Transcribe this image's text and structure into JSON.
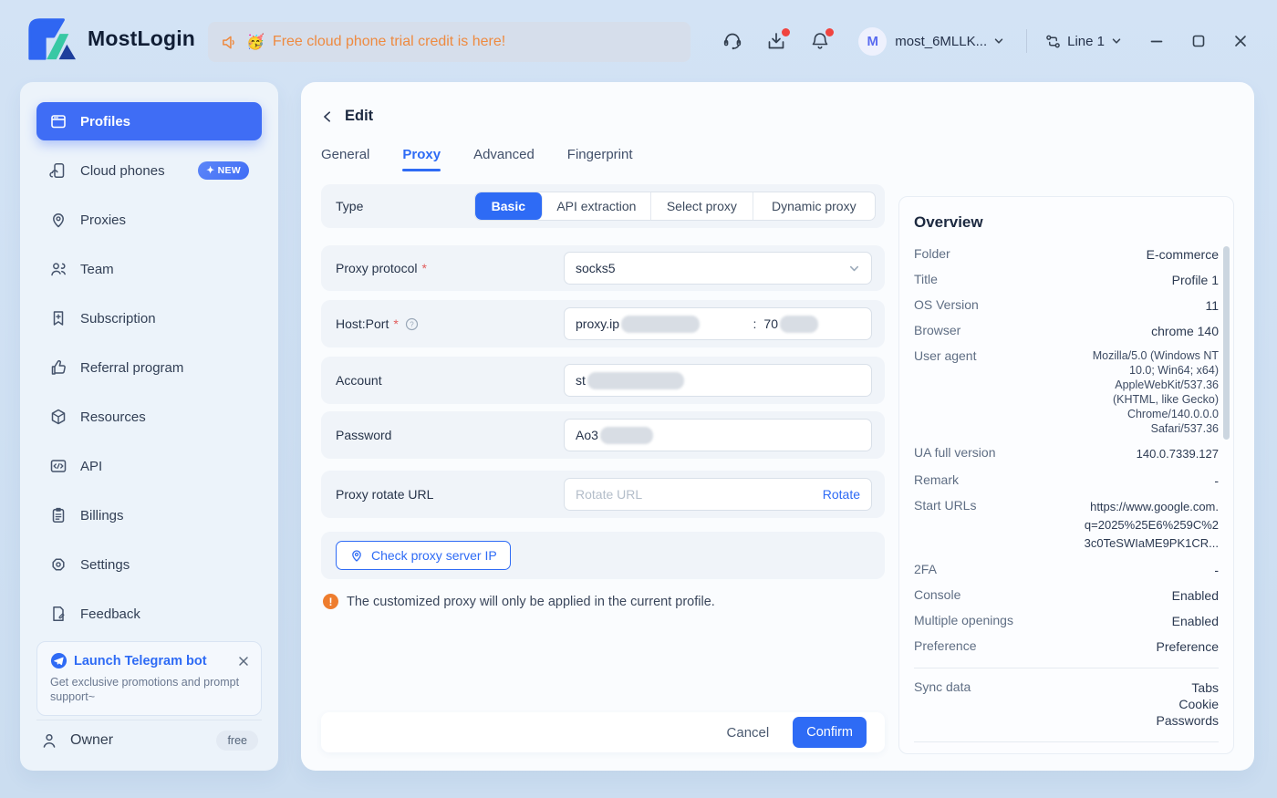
{
  "topbar": {
    "brand": "MostLogin",
    "banner": {
      "emoji": "🥳",
      "text": "Free cloud phone trial credit is here!"
    },
    "user": {
      "initial": "M",
      "name": "most_6MLLK..."
    },
    "line_label": "Line 1"
  },
  "sidebar": {
    "items": [
      {
        "label": "Profiles"
      },
      {
        "label": "Cloud phones",
        "badge": "✦ NEW"
      },
      {
        "label": "Proxies"
      },
      {
        "label": "Team"
      },
      {
        "label": "Subscription"
      },
      {
        "label": "Referral program"
      },
      {
        "label": "Resources"
      },
      {
        "label": "API"
      },
      {
        "label": "Billings"
      },
      {
        "label": "Settings"
      },
      {
        "label": "Feedback"
      }
    ],
    "telegram_card": {
      "title": "Launch Telegram bot",
      "subtitle": "Get exclusive promotions and prompt support~"
    },
    "owner": {
      "label": "Owner",
      "badge": "free"
    }
  },
  "main": {
    "back_title": "Edit",
    "tabs": [
      "General",
      "Proxy",
      "Advanced",
      "Fingerprint"
    ],
    "active_tab": "Proxy",
    "form": {
      "required_mark": "*",
      "type_label": "Type",
      "type_options": [
        "Basic",
        "API extraction",
        "Select proxy",
        "Dynamic proxy"
      ],
      "type_selected": "Basic",
      "proxy_protocol_label": "Proxy protocol",
      "proxy_protocol_value": "socks5",
      "host_port_label": "Host:Port",
      "host_value": "proxy.ip",
      "host_port_separator": ":",
      "port_value": "70",
      "account_label": "Account",
      "account_value": "st",
      "password_label": "Password",
      "password_value": "Ao3",
      "rotate_label": "Proxy rotate URL",
      "rotate_placeholder": "Rotate URL",
      "rotate_action": "Rotate",
      "check_ip_button": "Check proxy server IP",
      "notice": "The customized proxy will only be applied in the current profile.",
      "cancel": "Cancel",
      "confirm": "Confirm"
    }
  },
  "overview": {
    "title": "Overview",
    "rows": [
      {
        "label": "Folder",
        "value": "E-commerce"
      },
      {
        "label": "Title",
        "value": "Profile 1"
      },
      {
        "label": "OS Version",
        "value": "11"
      },
      {
        "label": "Browser",
        "value": "chrome 140"
      },
      {
        "label": "User agent",
        "value": "Mozilla/5.0 (Windows NT\n10.0; Win64; x64)\nAppleWebKit/537.36\n(KHTML, like Gecko)\nChrome/140.0.0.0\nSafari/537.36"
      },
      {
        "label": "UA full version",
        "value": "140.0.7339.127"
      },
      {
        "label": "Remark",
        "value": "-"
      },
      {
        "label": "Start URLs",
        "value": "https://www.google.com.\nq=2025%25E6%259C%2\n3c0TeSWIaME9PK1CR..."
      },
      {
        "label": "2FA",
        "value": "-"
      },
      {
        "label": "Console",
        "value": "Enabled"
      },
      {
        "label": "Multiple openings",
        "value": "Enabled"
      },
      {
        "label": "Preference",
        "value": "Preference"
      },
      {
        "label": "Sync data",
        "value": "Tabs\nCookie\nPasswords"
      }
    ]
  },
  "colors": {
    "accent": "#2e6bf5",
    "banner_text": "#ee8a40",
    "notification_dot": "#f0443f",
    "page_bg": "#cfe0f2"
  }
}
